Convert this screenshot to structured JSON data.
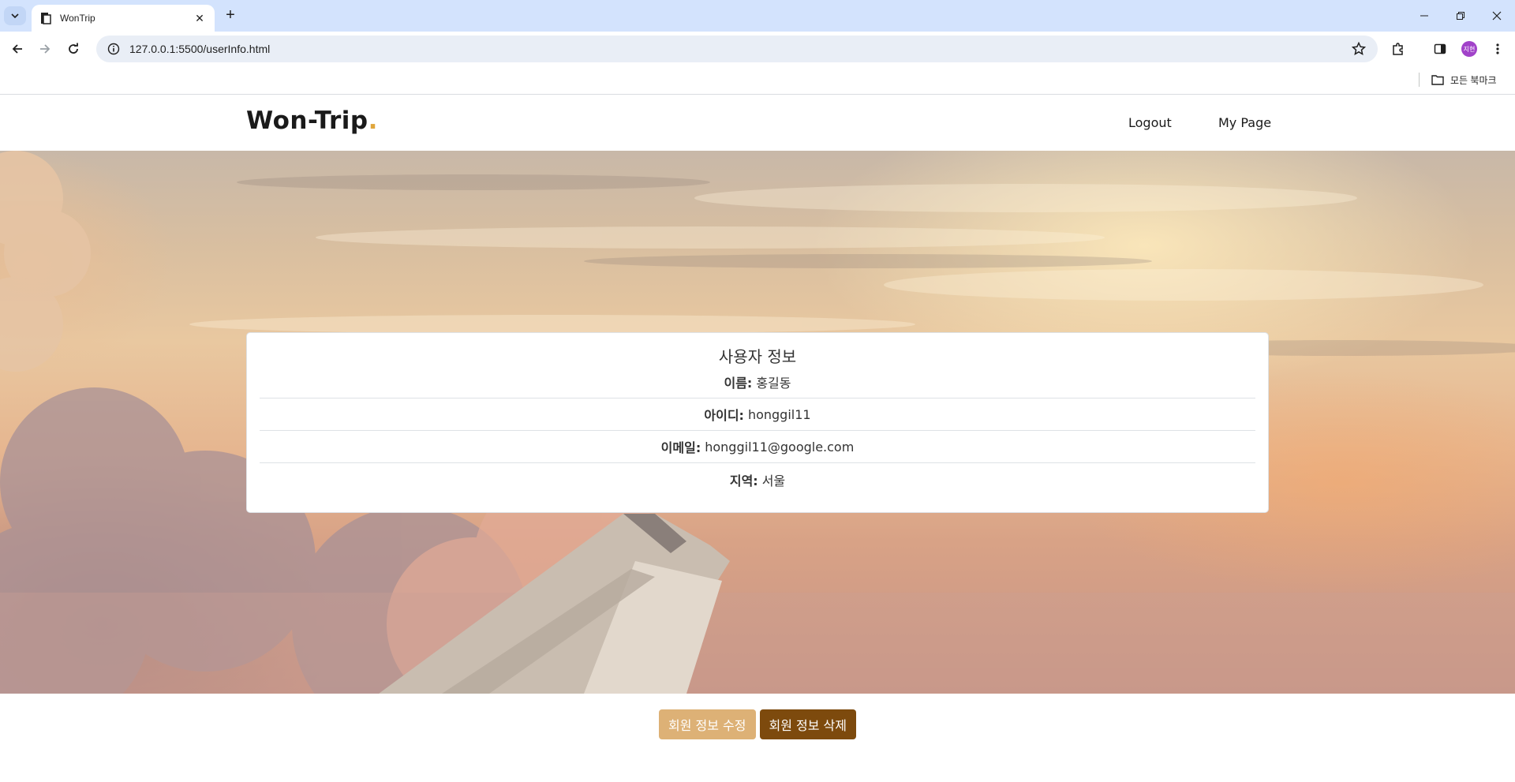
{
  "browser": {
    "tab_title": "WonTrip",
    "url": "127.0.0.1:5500/userInfo.html",
    "profile_label": "지현",
    "bookmarks_all": "모든 북마크"
  },
  "header": {
    "brand": "Won-Trip",
    "brand_dot": ".",
    "nav": {
      "logout": "Logout",
      "mypage": "My Page"
    }
  },
  "card": {
    "title": "사용자 정보",
    "rows": [
      {
        "label": "이름:",
        "value": "홍길동"
      },
      {
        "label": "아이디:",
        "value": "honggil11"
      },
      {
        "label": "이메일:",
        "value": "honggil11@google.com"
      },
      {
        "label": "지역:",
        "value": "서울"
      }
    ]
  },
  "buttons": {
    "edit": "회원 정보 수정",
    "delete": "회원 정보 삭제"
  },
  "colors": {
    "brand_dot": "#e0a63c",
    "edit_button": "#ddb176",
    "delete_button": "#7d4a0d"
  }
}
